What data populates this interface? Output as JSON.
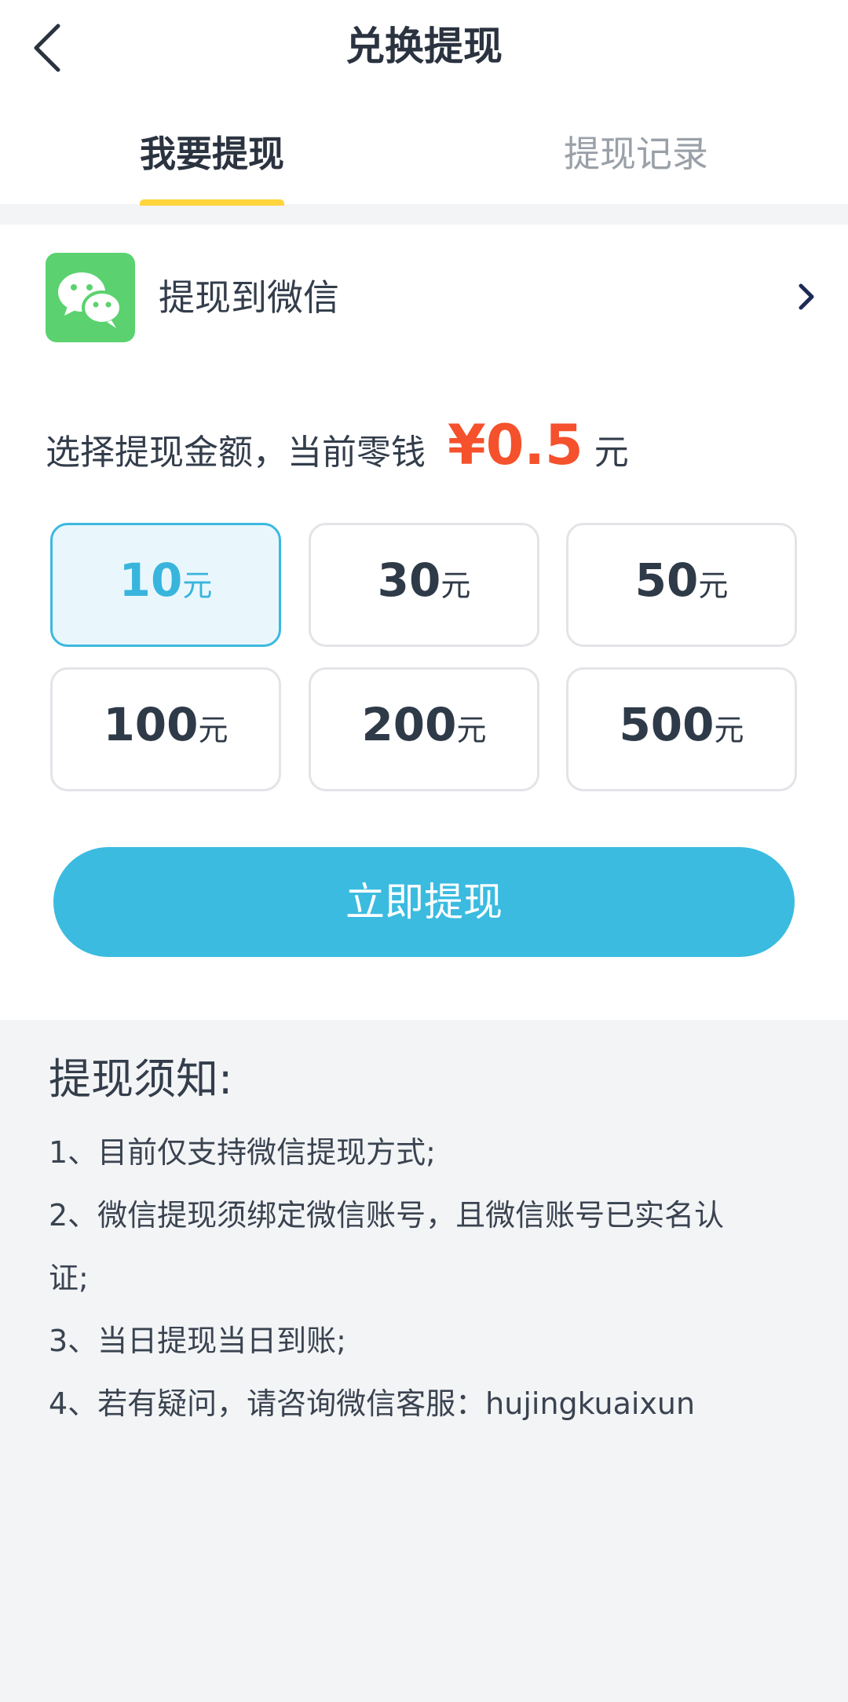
{
  "header": {
    "title": "兑换提现"
  },
  "tabs": [
    {
      "label": "我要提现",
      "active": true
    },
    {
      "label": "提现记录",
      "active": false
    }
  ],
  "method": {
    "label": "提现到微信",
    "icon": "wechat-icon"
  },
  "amount": {
    "prompt": "选择提现金额，当前零钱",
    "balance": "¥0.5",
    "unit": "元"
  },
  "options": [
    {
      "value": "10",
      "unit": "元",
      "selected": true
    },
    {
      "value": "30",
      "unit": "元",
      "selected": false
    },
    {
      "value": "50",
      "unit": "元",
      "selected": false
    },
    {
      "value": "100",
      "unit": "元",
      "selected": false
    },
    {
      "value": "200",
      "unit": "元",
      "selected": false
    },
    {
      "value": "500",
      "unit": "元",
      "selected": false
    }
  ],
  "submit": {
    "label": "立即提现"
  },
  "notice": {
    "title": "提现须知:",
    "items": [
      "1、目前仅支持微信提现方式;",
      "2、微信提现须绑定微信账号，且微信账号已实名认",
      "证;",
      "3、当日提现当日到账;",
      "4、若有疑问，请咨询微信客服：hujingkuaixun"
    ]
  },
  "colors": {
    "accent": "#3bbbe0",
    "tab_indicator": "#ffd43d",
    "balance": "#f4512c",
    "wechat": "#5bd26f"
  }
}
